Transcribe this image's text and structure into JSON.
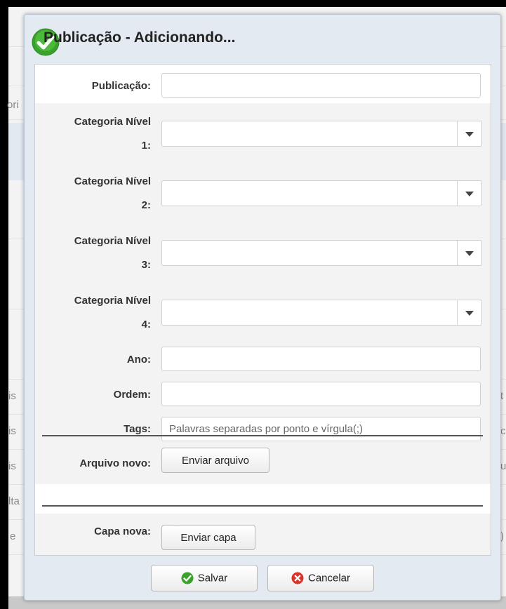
{
  "dialog": {
    "title": "Publicação - Adicionando..."
  },
  "form": {
    "publicacao": {
      "label": "Publicação:",
      "value": ""
    },
    "categoria1": {
      "label_line1": "Categoria Nível",
      "label_line2": "1:",
      "value": ""
    },
    "categoria2": {
      "label_line1": "Categoria Nível",
      "label_line2": "2:",
      "value": ""
    },
    "categoria3": {
      "label_line1": "Categoria Nível",
      "label_line2": "3:",
      "value": ""
    },
    "categoria4": {
      "label_line1": "Categoria Nível",
      "label_line2": "4:",
      "value": ""
    },
    "ano": {
      "label": "Ano:",
      "value": ""
    },
    "ordem": {
      "label": "Ordem:",
      "value": ""
    },
    "tags": {
      "label": "Tags:",
      "value": "",
      "placeholder": "Palavras separadas por ponto e vírgula(;)"
    },
    "arquivo": {
      "label": "Arquivo novo:",
      "button": "Enviar arquivo"
    },
    "capa": {
      "label": "Capa nova:",
      "button": "Enviar capa"
    }
  },
  "footer": {
    "save_label": "Salvar",
    "cancel_label": "Cancelar"
  },
  "background": {
    "fragments": [
      "ori",
      "is",
      "is",
      "is",
      "lta",
      "e",
      "t",
      "c",
      "u",
      ")"
    ]
  },
  "colors": {
    "success": "#3aa12c",
    "danger": "#d9332a"
  }
}
